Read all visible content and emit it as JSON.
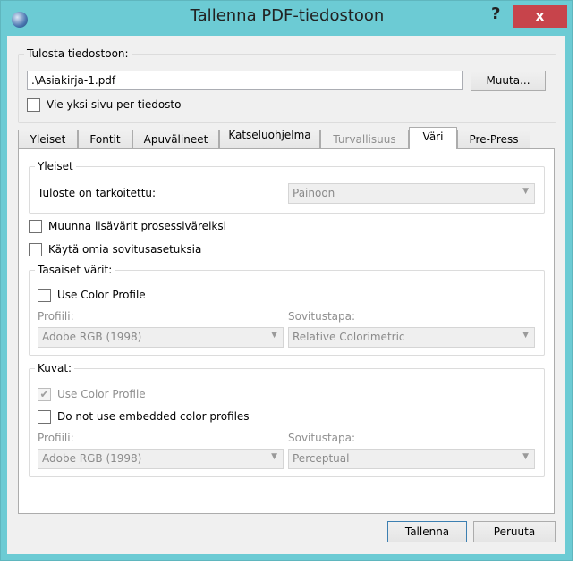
{
  "window": {
    "title": "Tallenna PDF-tiedostoon",
    "help_label": "?",
    "close_label": "x"
  },
  "output": {
    "group_label": "Tulosta tiedostoon:",
    "file_value": ".\\Asiakirja-1.pdf",
    "change_button": "Muuta...",
    "one_page_label": "Vie yksi sivu per tiedosto",
    "one_page_checked": false
  },
  "tabs": [
    {
      "label": "Yleiset"
    },
    {
      "label": "Fontit"
    },
    {
      "label": "Apuvälineet"
    },
    {
      "label": "Katseluohjelma"
    },
    {
      "label": "Turvallisuus",
      "disabled": true
    },
    {
      "label": "Väri",
      "selected": true
    },
    {
      "label": "Pre-Press"
    }
  ],
  "general": {
    "group_label": "Yleiset",
    "intended_label": "Tuloste on tarkoitettu:",
    "intended_value": "Painoon"
  },
  "convert_spot": {
    "label": "Muunna lisävärit prosessiväreiksi",
    "checked": false
  },
  "custom_settings": {
    "label": "Käytä omia sovitusasetuksia",
    "checked": false
  },
  "solid": {
    "group_label": "Tasaiset värit:",
    "use_profile_label": "Use Color Profile",
    "use_profile_checked": false,
    "profile_label": "Profiili:",
    "profile_value": "Adobe RGB (1998)",
    "intent_label": "Sovitustapa:",
    "intent_value": "Relative Colorimetric"
  },
  "images": {
    "group_label": "Kuvat:",
    "use_profile_label": "Use Color Profile",
    "use_profile_checked": true,
    "no_embedded_label": "Do not use embedded color profiles",
    "no_embedded_checked": false,
    "profile_label": "Profiili:",
    "profile_value": "Adobe RGB (1998)",
    "intent_label": "Sovitustapa:",
    "intent_value": "Perceptual"
  },
  "buttons": {
    "save": "Tallenna",
    "cancel": "Peruuta"
  },
  "icons": {
    "check": "✔",
    "dropdown": "▼"
  },
  "colors": {
    "titlebar": "#6ccbd4",
    "close": "#c7444b"
  }
}
